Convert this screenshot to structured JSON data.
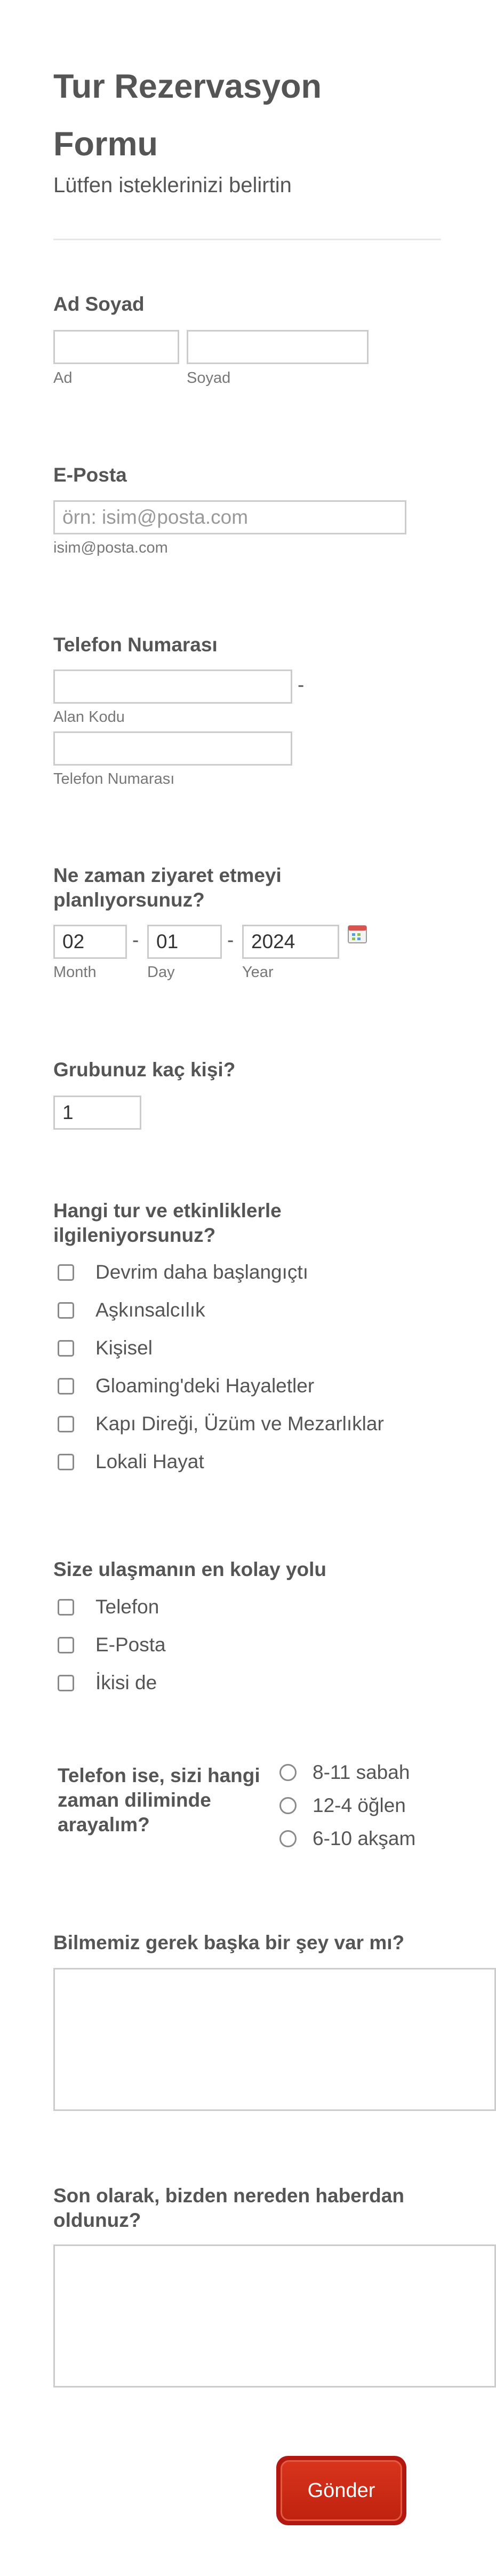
{
  "form": {
    "title": "Tur Rezervasyon Formu",
    "subtitle": "Lütfen isteklerinizi belirtin"
  },
  "name": {
    "label": "Ad Soyad",
    "first_sub": "Ad",
    "last_sub": "Soyad",
    "first_value": "",
    "last_value": ""
  },
  "email": {
    "label": "E-Posta",
    "placeholder": "örn: isim@posta.com",
    "hint": "isim@posta.com",
    "value": ""
  },
  "phone": {
    "label": "Telefon Numarası",
    "area_sub": "Alan Kodu",
    "number_sub": "Telefon Numarası",
    "separator": "-"
  },
  "visit_date": {
    "label": "Ne zaman ziyaret etmeyi planlıyorsunuz?",
    "month_value": "02",
    "day_value": "01",
    "year_value": "2024",
    "month_sub": "Month",
    "day_sub": "Day",
    "year_sub": "Year",
    "separator": "-",
    "calendar_icon": "calendar-icon"
  },
  "group_size": {
    "label": "Grubunuz kaç kişi?",
    "value": "1"
  },
  "tours": {
    "label": "Hangi tur ve etkinliklerle ilgileniyorsunuz?",
    "options": [
      "Devrim daha başlangıçtı",
      "Aşkınsalcılık",
      "Kişisel",
      "Gloaming'deki Hayaletler",
      "Kapı Direği, Üzüm ve Mezarlıklar",
      "Lokali Hayat"
    ]
  },
  "contact": {
    "label": "Size ulaşmanın en kolay yolu",
    "options": [
      "Telefon",
      "E-Posta",
      "İkisi de"
    ]
  },
  "call_time": {
    "label": "Telefon ise, sizi hangi zaman diliminde arayalım?",
    "options": [
      "8-11 sabah",
      "12-4 öğlen",
      "6-10 akşam"
    ]
  },
  "anything_else": {
    "label": "Bilmemiz gerek başka bir şey var mı?"
  },
  "referral": {
    "label": "Son olarak, bizden nereden haberdan oldunuz?"
  },
  "submit": {
    "label": "Gönder",
    "color": "#b31810"
  }
}
